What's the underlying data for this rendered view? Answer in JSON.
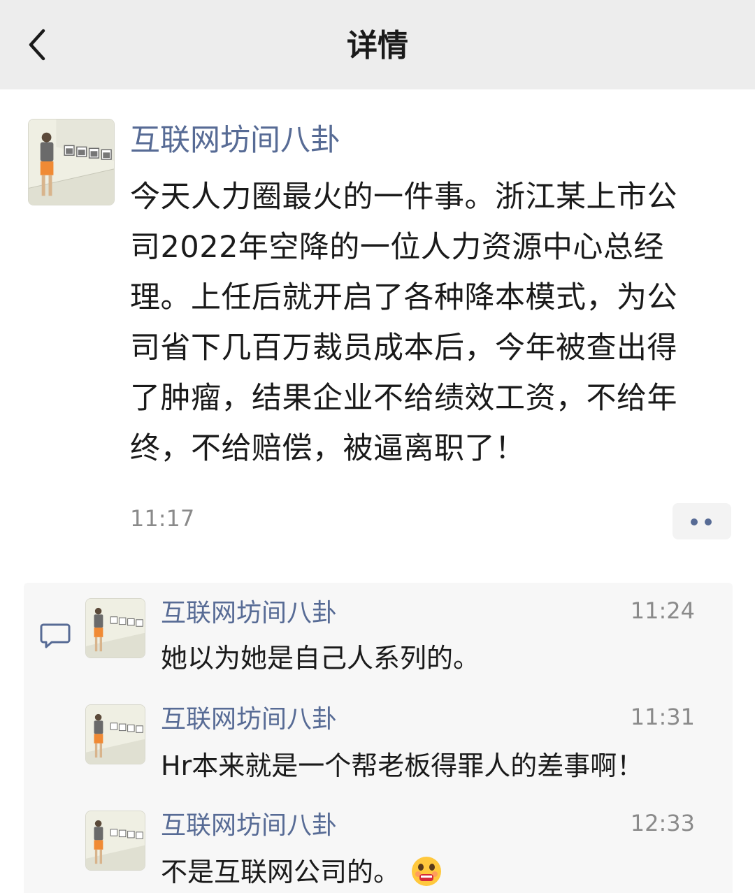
{
  "nav": {
    "title": "详情",
    "back_icon": "chevron-left-icon"
  },
  "post": {
    "author": "互联网坊间八卦",
    "lines": [
      "今天人力圈最火的一件事。浙江某上市公",
      "司2022年空降的一位人力资源中心总经",
      "理。上任后就开启了各种降本模式，为公",
      "司省下几百万裁员成本后，今年被查出得",
      "了肿瘤，结果企业不给绩效工资，不给年",
      "终，不给赔偿，被逼离职了！"
    ],
    "time": "11:17",
    "more_icon": "more-dots-icon"
  },
  "comments": {
    "icon": "comment-icon",
    "items": [
      {
        "author": "互联网坊间八卦",
        "time": "11:24",
        "text": "她以为她是自己人系列的。"
      },
      {
        "author": "互联网坊间八卦",
        "time": "11:31",
        "text": "Hr本来就是一个帮老板得罪人的差事啊！"
      },
      {
        "author": "互联网坊间八卦",
        "time": "12:33",
        "text": "不是互联网公司的。",
        "emoji": "grimace-emoji-icon"
      }
    ]
  },
  "colors": {
    "link_blue": "#576b95",
    "nav_bg": "#ededed",
    "comment_bg": "#f7f7f7",
    "time_gray": "#8a8a8a"
  }
}
